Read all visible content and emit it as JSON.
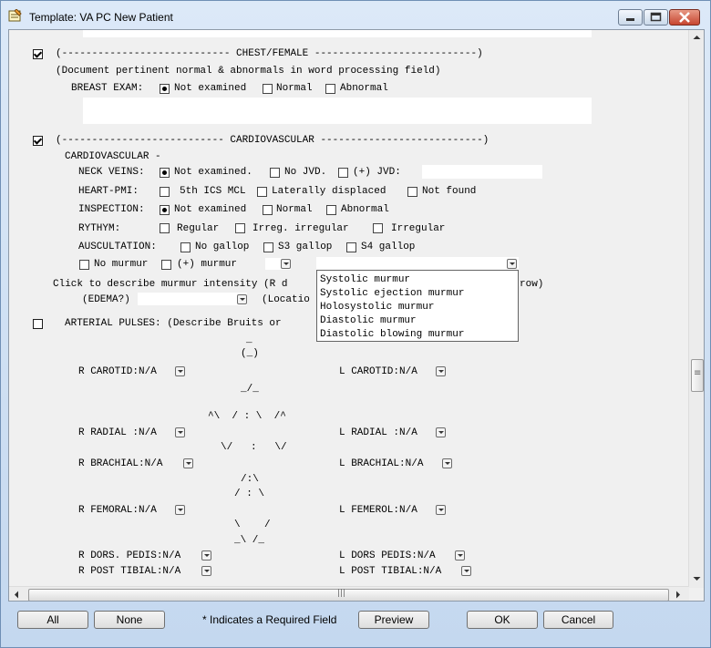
{
  "window": {
    "title": "Template: VA PC New Patient"
  },
  "chest": {
    "header": "(---------------------------- CHEST/FEMALE ---------------------------)",
    "note": "(Document pertinent normal & abnormals in word processing field)",
    "breast_label": "BREAST EXAM:",
    "breast_options": [
      "Not examined",
      "Normal",
      "Abnormal"
    ]
  },
  "cardio": {
    "header": "(--------------------------- CARDIOVASCULAR ---------------------------)",
    "sub": "CARDIOVASCULAR -",
    "neck_label": "NECK VEINS:",
    "neck_options": [
      "Not examined.",
      "No JVD.",
      "(+) JVD:"
    ],
    "pmi_label": "HEART-PMI:",
    "pmi_options": [
      "5th ICS MCL",
      "Laterally displaced",
      "Not found"
    ],
    "insp_label": "INSPECTION:",
    "insp_options": [
      "Not examined",
      "Normal",
      "Abnormal"
    ],
    "rhythm_label": "RYTHYM:",
    "rhythm_options": [
      "Regular",
      "Irreg. irregular",
      "Irregular"
    ],
    "ausc_label": "AUSCULTATION:",
    "ausc_options": [
      "No gallop",
      "S3 gallop",
      "S4 gallop"
    ],
    "murmur_options": [
      "No murmur",
      "(+) murmur"
    ],
    "intensity_left": "Click to describe murmur intensity (R d",
    "intensity_right": "row)",
    "edema_label": "(EDEMA?)",
    "location_label": "(Locatio"
  },
  "murmur_popup": [
    "Systolic murmur",
    "Systolic ejection murmur",
    "Holosystolic murmur",
    "Diastolic murmur",
    "Diastolic blowing murmur"
  ],
  "arterial": {
    "label": "ARTERIAL PULSES: (Describe Bruits or",
    "art": [
      "_",
      "(_)",
      "_/_",
      "^\\  / : \\  /^",
      "\\/   :   \\/",
      "/:\\",
      "/ : \\",
      "\\    /",
      "_\\ /_"
    ],
    "rows": [
      {
        "left": "R CAROTID:N/A",
        "right": "L CAROTID:N/A"
      },
      {
        "left": "R RADIAL :N/A",
        "right": "L RADIAL :N/A"
      },
      {
        "left": "R BRACHIAL:N/A",
        "right": "L BRACHIAL:N/A"
      },
      {
        "left": "R FEMORAL:N/A",
        "right": "L FEMEROL:N/A"
      },
      {
        "left": "R DORS. PEDIS:N/A",
        "right": "L DORS PEDIS:N/A"
      },
      {
        "left": "R POST TIBIAL:N/A",
        "right": "L POST TIBIAL:N/A"
      }
    ]
  },
  "scroll": {
    "grip": "≡",
    "hgrip": "|||"
  },
  "footer": {
    "all": "All",
    "none": "None",
    "note": "* Indicates a Required Field",
    "preview": "Preview",
    "ok": "OK",
    "cancel": "Cancel"
  }
}
